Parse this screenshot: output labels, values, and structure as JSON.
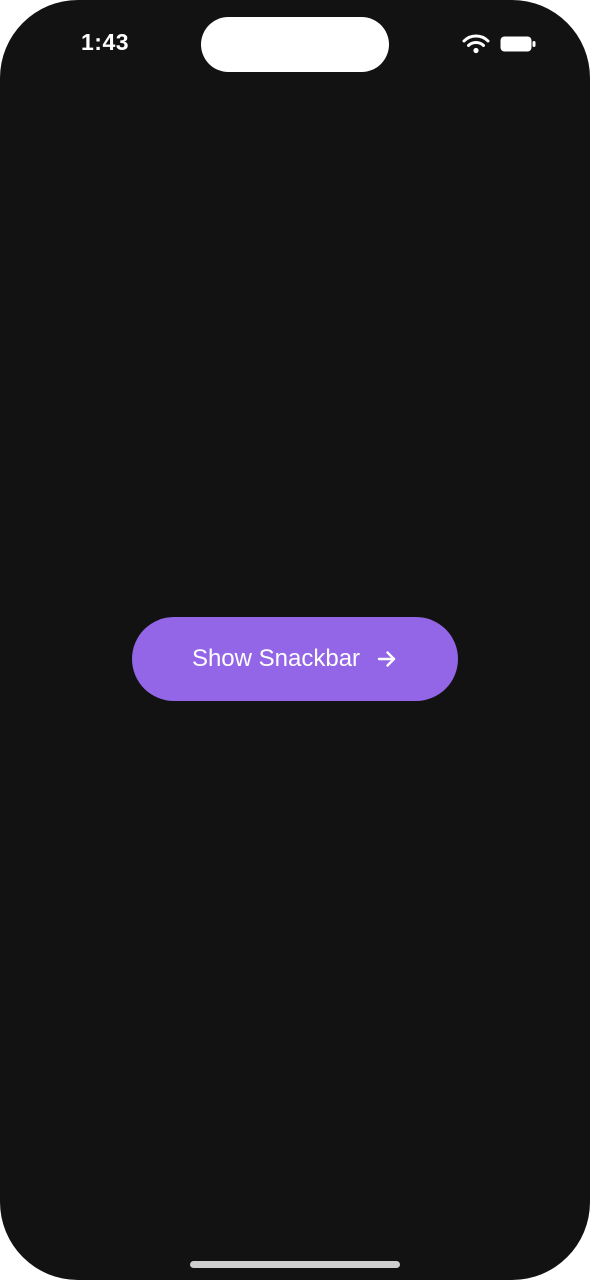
{
  "status_bar": {
    "time": "1:43",
    "wifi_icon": "wifi-icon",
    "battery_icon": "battery-icon"
  },
  "main": {
    "button_label": "Show Snackbar",
    "button_icon": "arrow-right-icon",
    "button_color": "#9266e6",
    "background_color": "#121212"
  }
}
